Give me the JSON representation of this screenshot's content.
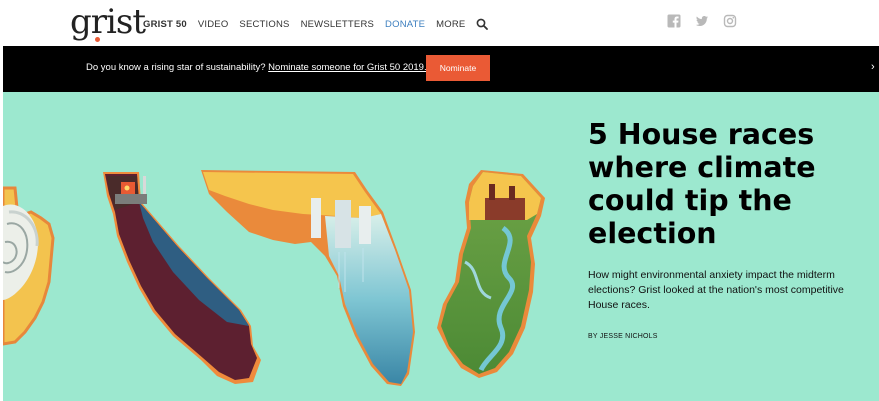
{
  "header": {
    "logo_text": "grist",
    "nav": [
      {
        "label": "GRIST 50"
      },
      {
        "label": "VIDEO"
      },
      {
        "label": "SECTIONS"
      },
      {
        "label": "NEWSLETTERS"
      },
      {
        "label": "DONATE"
      },
      {
        "label": "MORE"
      }
    ],
    "search_icon": "search-icon",
    "social_icons": [
      "facebook-icon",
      "twitter-icon",
      "instagram-icon"
    ]
  },
  "banner": {
    "text": "Do you know a rising star of sustainability?",
    "link_text": "Nominate someone for Grist 50 2019.",
    "button_label": "Nominate",
    "close_glyph": "›"
  },
  "hero": {
    "headline": "5 House races where climate could tip the election",
    "dek": "How might environmental anxiety impact the midterm elections? Grist looked at the nation's most competitive House races.",
    "byline": "BY JESSE NICHOLS"
  },
  "colors": {
    "accent": "#ea5a35",
    "link_blue": "#3d7fbf",
    "hero_bg": "#9ce8cf",
    "banner_bg": "#000000"
  }
}
